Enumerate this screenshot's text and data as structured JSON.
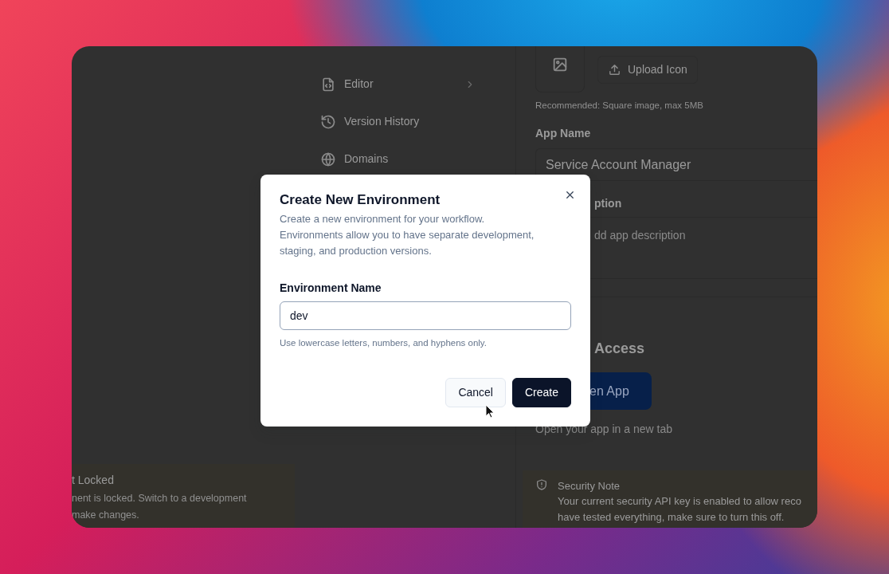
{
  "sidebar": {
    "items": [
      {
        "label": "Editor",
        "expandable": true
      },
      {
        "label": "Version History",
        "expandable": false
      },
      {
        "label": "Domains",
        "expandable": false
      }
    ]
  },
  "settings": {
    "upload_button": "Upload Icon",
    "icon_hint": "Recommended: Square image, max 5MB",
    "app_name_label": "App Name",
    "app_name_value": "Service Account Manager",
    "description_label": "ption",
    "description_placeholder": "dd app description",
    "access_heading": "Access",
    "open_app_button": "en App",
    "open_app_hint": "Open your app in a new tab"
  },
  "lock_notice": {
    "title": "t Locked",
    "lines": [
      "nent is locked. Switch to a development",
      "make changes."
    ]
  },
  "security_note": {
    "title": "Security Note",
    "lines": [
      "Your current security API key is enabled to allow reco",
      "have tested everything, make sure to turn this off."
    ]
  },
  "dialog": {
    "title": "Create New Environment",
    "description": [
      "Create a new environment for your workflow.",
      "Environments allow you to have separate development, staging, and production versions."
    ],
    "field_label": "Environment Name",
    "field_value": "dev",
    "hint": "Use lowercase letters, numbers, and hyphens only.",
    "buttons": [
      {
        "label": "Cancel",
        "kind": "secondary"
      },
      {
        "label": "Create",
        "kind": "primary"
      }
    ]
  }
}
